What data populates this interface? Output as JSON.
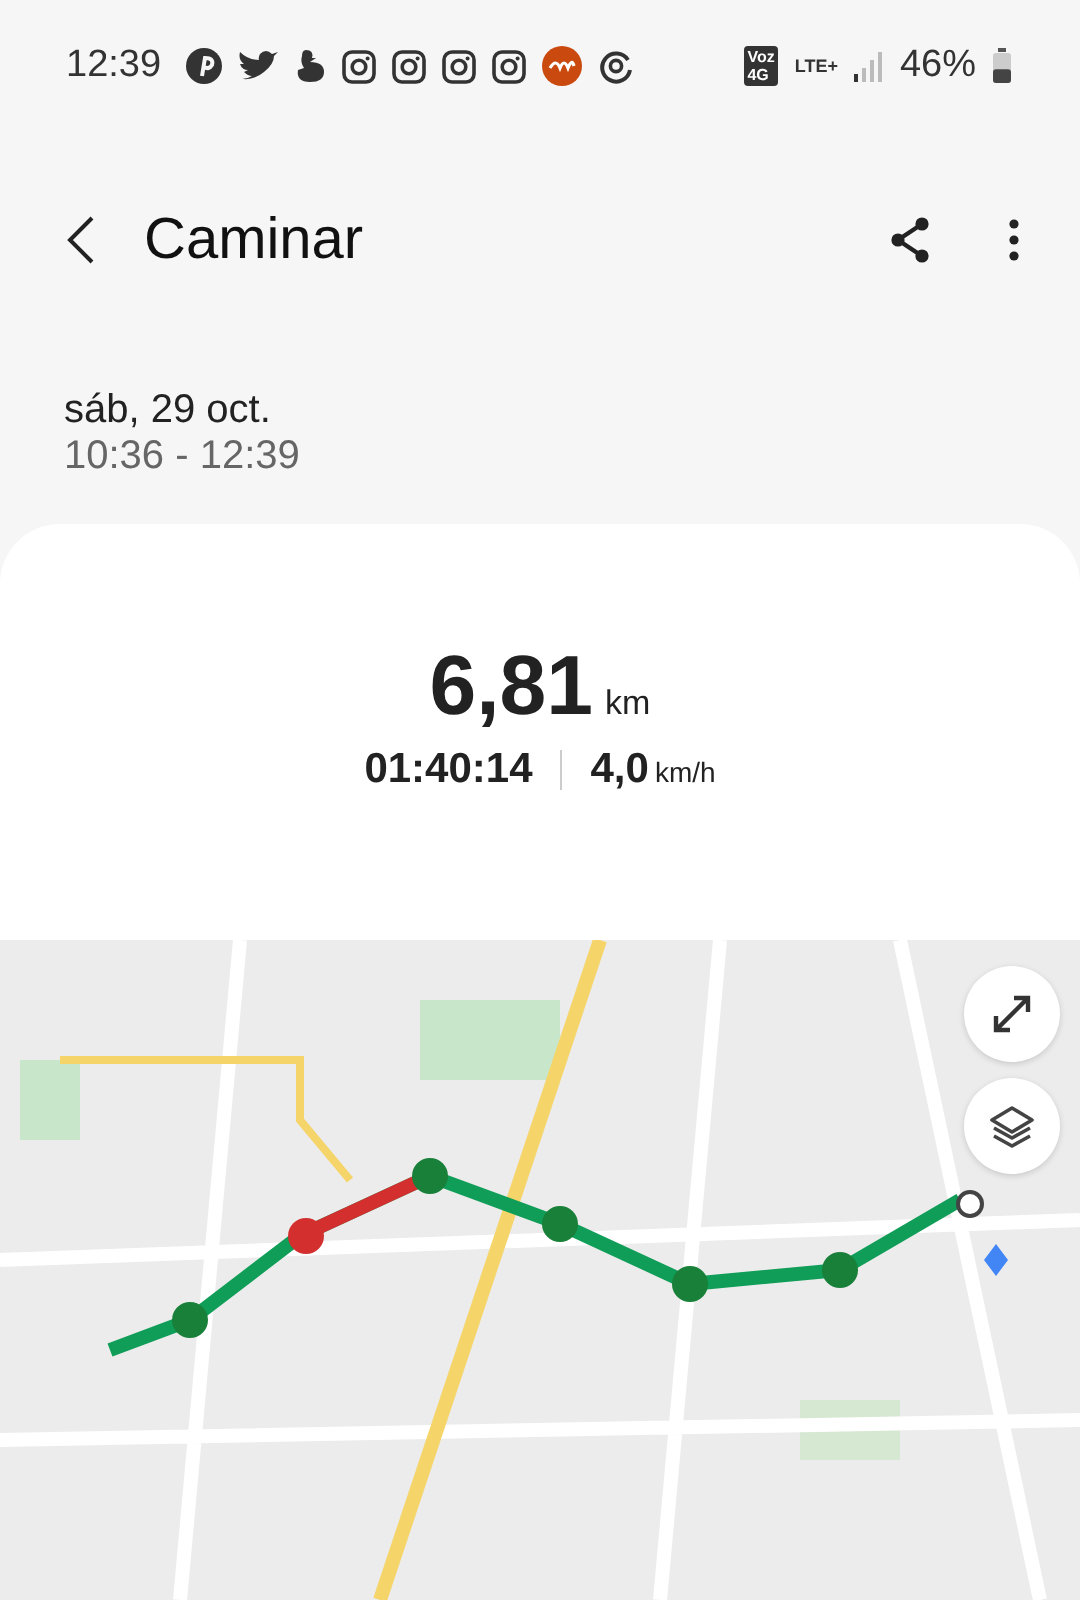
{
  "status_bar": {
    "time": "12:39",
    "network_top": "Voz",
    "network_bottom": "4G",
    "lte": "LTE+",
    "battery": "46%"
  },
  "header": {
    "title": "Caminar"
  },
  "session": {
    "date": "sáb, 29 oct.",
    "time_range": "10:36 - 12:39"
  },
  "summary": {
    "distance": "6,81",
    "distance_unit": "km",
    "duration": "01:40:14",
    "speed": "4,0",
    "speed_unit": "km/h"
  }
}
